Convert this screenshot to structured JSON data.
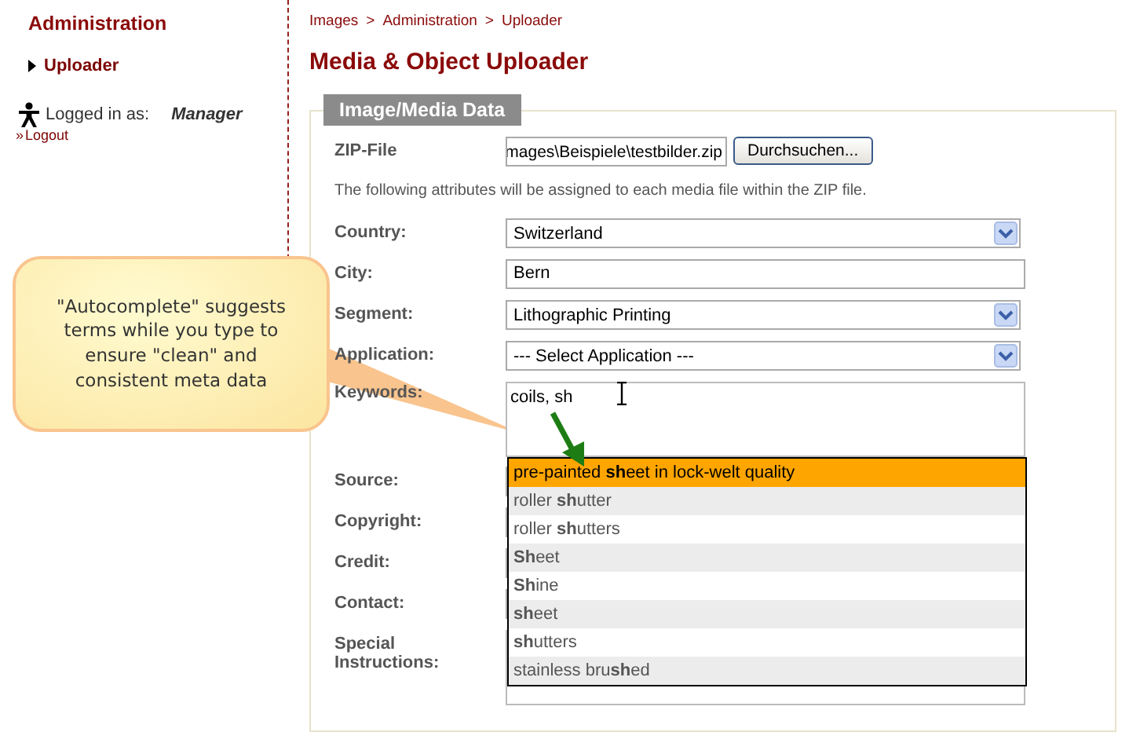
{
  "sidebar": {
    "heading": "Administration",
    "items": [
      {
        "label": "Uploader",
        "selected": true
      }
    ],
    "logged_in_label": "Logged in as:",
    "user": "Manager",
    "logout_marker": "»",
    "logout": "Logout"
  },
  "breadcrumb": {
    "separator": ">",
    "items": [
      "Images",
      "Administration",
      "Uploader"
    ]
  },
  "page_title": "Media & Object Uploader",
  "section_title": "Image/Media Data",
  "zip": {
    "label": "ZIP-File",
    "value": "mages\\Beispiele\\testbilder.zip",
    "button": "Durchsuchen..."
  },
  "description": "The following attributes will be assigned to each media file within the ZIP file.",
  "fields": [
    {
      "kind": "select",
      "label": "Country:",
      "value": "Switzerland"
    },
    {
      "kind": "text",
      "label": "City:",
      "value": "Bern"
    },
    {
      "kind": "select",
      "label": "Segment:",
      "value": "Lithographic Printing"
    },
    {
      "kind": "select",
      "label": "Application:",
      "value": "--- Select Application ---"
    },
    {
      "kind": "keywords",
      "label": "Keywords:",
      "value": "coils, sh"
    },
    {
      "kind": "text",
      "label": "Source:"
    },
    {
      "kind": "text",
      "label": "Copyright:"
    },
    {
      "kind": "text",
      "label": "Credit:"
    },
    {
      "kind": "text",
      "label": "Contact:"
    },
    {
      "kind": "textarea",
      "label": "Special Instructions:"
    }
  ],
  "autocomplete": [
    {
      "text": "pre-painted **sh**eet in lock-welt quality",
      "selected": true
    },
    {
      "text": "roller **sh**utter",
      "selected": false
    },
    {
      "text": "roller **sh**utters",
      "selected": false
    },
    {
      "text": "**Sh**eet",
      "selected": false
    },
    {
      "text": "**Sh**ine",
      "selected": false
    },
    {
      "text": "**sh**eet",
      "selected": false
    },
    {
      "text": "**sh**utters",
      "selected": false
    },
    {
      "text": "stainless bru**sh**ed",
      "selected": false
    }
  ],
  "callout": "\"Autocomplete\" suggests terms while you type to ensure \"clean\" and consistent meta data"
}
